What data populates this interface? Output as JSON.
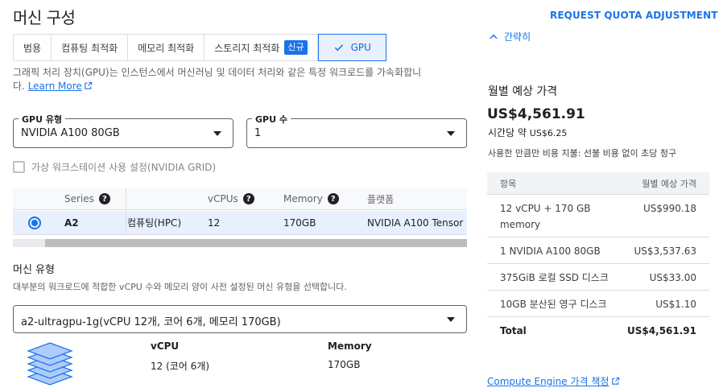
{
  "header": {
    "title": "머신 구성",
    "quota_link": "REQUEST QUOTA ADJUSTMENT",
    "collapse_label": "간략히"
  },
  "tabs": [
    {
      "label": "범용"
    },
    {
      "label": "컴퓨팅 최적화"
    },
    {
      "label": "메모리 최적화"
    },
    {
      "label": "스토리지 최적화",
      "badge": "신규"
    },
    {
      "label": "GPU",
      "active": true
    }
  ],
  "gpu_description": {
    "text": "그래픽 처리 장치(GPU)는 인스턴스에서 머신러닝 및 데이터 처리와 같은 특정 워크로드를 가속화합니다.",
    "link": "Learn More"
  },
  "gpu_type": {
    "label": "GPU 유형",
    "value": "NVIDIA A100 80GB"
  },
  "gpu_count": {
    "label": "GPU 수",
    "value": "1"
  },
  "virtual_workstation": {
    "label": "가상 워크스테이션 사용 설정(NVIDIA GRID)",
    "checked": false
  },
  "series_table": {
    "columns": {
      "series": "Series",
      "vcpus": "vCPUs",
      "memory": "Memory",
      "platform": "플랫폼"
    },
    "rows": [
      {
        "series": "A2",
        "category": "컴퓨팅(HPC)",
        "vcpus": "12",
        "memory": "170GB",
        "platform": "NVIDIA A100 Tensor",
        "selected": true
      }
    ]
  },
  "machine_type": {
    "title": "머신 유형",
    "description": "대부분의 워크로드에 적합한 vCPU 수와 메모리 양이 사전 설정된 머신 유형을 선택합니다.",
    "value": "a2-ultragpu-1g(vCPU 12개, 코어 6개, 메모리 170GB)"
  },
  "specs": {
    "vcpu_label": "vCPU",
    "vcpu_value": "12 (코어 6개)",
    "memory_label": "Memory",
    "memory_value": "170GB"
  },
  "pricing": {
    "title": "월별 예상 가격",
    "total": "US$4,561.91",
    "hourly_prefix": "시간당 약 ",
    "hourly_value": "US$6.25",
    "note": "사용한 만큼만 비용 지불: 선불 비용 없이 초당 청구",
    "table_head": {
      "item": "항목",
      "estimate": "월별 예상 가격"
    },
    "items": [
      {
        "label": "12 vCPU + 170 GB memory",
        "amount": "US$990.18"
      },
      {
        "label": "1 NVIDIA A100 80GB",
        "amount": "US$3,537.63"
      },
      {
        "label": "375GiB 로컬 SSD 디스크",
        "amount": "US$33.00"
      },
      {
        "label": "10GB 분산된 영구 디스크",
        "amount": "US$1.10"
      }
    ],
    "total_row": {
      "label": "Total",
      "amount": "US$4,561.91"
    },
    "link": "Compute Engine 가격 책정"
  },
  "colors": {
    "accent": "#1a73e8",
    "selected_row": "#e8f0fe"
  }
}
